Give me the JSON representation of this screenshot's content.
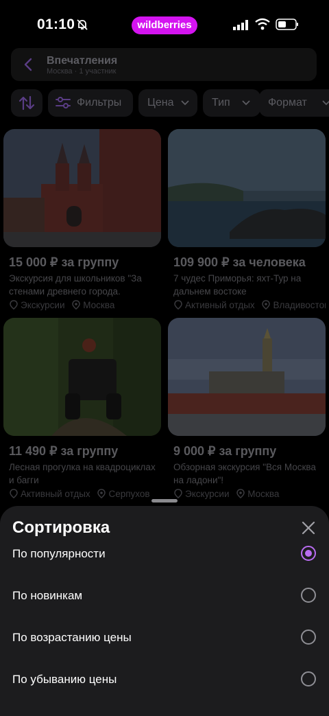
{
  "status_bar": {
    "time": "01:10",
    "brand": "wildberries"
  },
  "header": {
    "title": "Впечатления",
    "subtitle": "Москва · 1 участник"
  },
  "chips": {
    "filters": "Фильтры",
    "price": "Цена",
    "type": "Тип",
    "format": "Формат"
  },
  "cards": [
    {
      "price": "15 000 ₽ за группу",
      "description": "Экскурсия для школьников \"За стенами древнего города. Прогулка",
      "category": "Экскурсии",
      "location": "Москва"
    },
    {
      "price": "109 900 ₽ за человека",
      "description": "7 чудес Приморья: яхт-Тур на дальнем востоке",
      "category": "Активный отдых",
      "location": "Владивосток"
    },
    {
      "price": "11 490 ₽ за группу",
      "description": "Лесная прогулка на квадроциклах и багги",
      "category": "Активный отдых",
      "location": "Серпухов"
    },
    {
      "price": "9 000 ₽ за группу",
      "description": "Обзорная экскурсия \"Вся Москва на ладони\"!",
      "category": "Экскурсии",
      "location": "Москва"
    }
  ],
  "sort_sheet": {
    "title": "Сортировка",
    "options": [
      {
        "label": "По популярности",
        "selected": true
      },
      {
        "label": "По новинкам",
        "selected": false
      },
      {
        "label": "По возрастанию цены",
        "selected": false
      },
      {
        "label": "По убыванию цены",
        "selected": false
      }
    ]
  },
  "colors": {
    "accent": "#b86cf0",
    "brand": "#d414f0",
    "sheet_bg": "#1c1c1e"
  }
}
